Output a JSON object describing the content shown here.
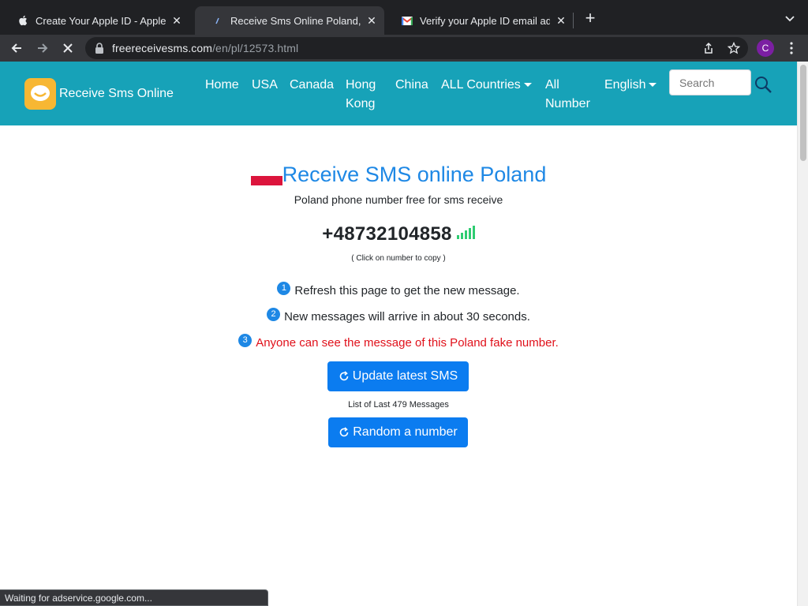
{
  "browser": {
    "tabs": [
      {
        "title": "Create Your Apple ID - Apple",
        "icon": "apple-icon",
        "active": false
      },
      {
        "title": "Receive Sms Online Poland,Pol",
        "icon": "site-icon",
        "active": true
      },
      {
        "title": "Verify your Apple ID email addr",
        "icon": "gmail-icon",
        "active": false
      }
    ],
    "url_host": "freereceivesms.com",
    "url_path": "/en/pl/12573.html",
    "profile_initial": "C",
    "status_text": "Waiting for adservice.google.com..."
  },
  "site": {
    "brand": "Receive Sms Online",
    "nav": [
      {
        "label": "Home"
      },
      {
        "label": "USA"
      },
      {
        "label": "Canada"
      },
      {
        "label": "Hong Kong"
      },
      {
        "label": "China"
      },
      {
        "label": "ALL Countries"
      },
      {
        "label": "All Number"
      },
      {
        "label": "English"
      }
    ],
    "search_placeholder": "Search"
  },
  "main": {
    "title": "Receive SMS online Poland",
    "subtitle": "Poland phone number free for sms receive",
    "phone_number": "+48732104858",
    "copy_hint": "( Click on number to copy )",
    "steps": [
      {
        "num": "1",
        "text": "Refresh this page to get the new message."
      },
      {
        "num": "2",
        "text": "New messages will arrive in about 30 seconds."
      },
      {
        "num": "3",
        "text": "Anyone can see the message of this Poland fake number."
      }
    ],
    "update_button": "Update latest SMS",
    "message_count_note": "List of Last 479 Messages",
    "random_button": "Random a number"
  },
  "colors": {
    "navbar": "#17a2b8",
    "accent_blue": "#1e88e5",
    "button_blue": "#0b7cf0",
    "warning_red": "#e0101a",
    "signal_green": "#2ecc71"
  }
}
